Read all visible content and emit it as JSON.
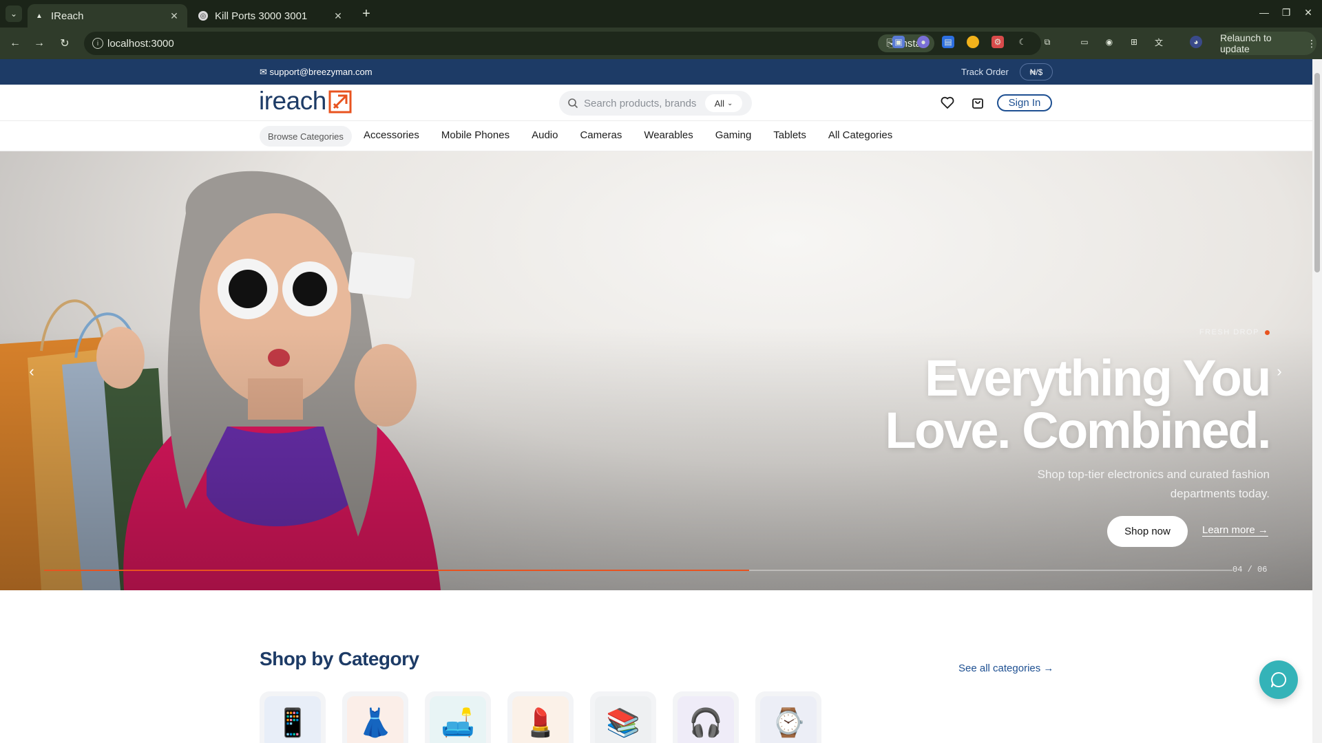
{
  "browser": {
    "tabs": [
      {
        "title": "IReach",
        "active": true
      },
      {
        "title": "Kill Ports 3000 3001",
        "active": false
      }
    ],
    "url": "localhost:3000",
    "install_label": "Install",
    "relaunch_label": "Relaunch to update",
    "theme_color": "#2f3b2a"
  },
  "topbar": {
    "email": "✉ support@breezyman.com",
    "track_order": "Track Order",
    "currency": "₦/$",
    "background": "#1d3b66"
  },
  "header": {
    "logo_text": "ireach",
    "search_placeholder": "Search products, brands",
    "search_filter": "All",
    "signin_label": "Sign In"
  },
  "nav": {
    "browse_label": "Browse Categories",
    "links": [
      "Accessories",
      "Mobile Phones",
      "Audio",
      "Cameras",
      "Wearables",
      "Gaming",
      "Tablets",
      "All Categories"
    ]
  },
  "hero": {
    "eyebrow": "FRESH DROP",
    "headline_line1": "Everything You",
    "headline_line2": "Love. Combined.",
    "subhead": "Shop top-tier electronics and curated fashion departments today.",
    "primary_cta": "Shop now",
    "secondary_cta": "Learn more →",
    "slide_counter": "04 / 06",
    "slide_progress": 0.593,
    "accent": "#e8531f"
  },
  "categories": {
    "title": "Shop by Category",
    "see_all": "See all categories →",
    "tiles": [
      {
        "icon": "📱",
        "icon_name": "mobile-phone-icon",
        "bg": "#e8eef8"
      },
      {
        "icon": "👗",
        "icon_name": "dress-icon",
        "bg": "#fbeee8"
      },
      {
        "icon": "🛋️",
        "icon_name": "sofa-lamp-icon",
        "bg": "#e8f4f5"
      },
      {
        "icon": "💄",
        "icon_name": "lipstick-icon",
        "bg": "#fbf1e8"
      },
      {
        "icon": "📚",
        "icon_name": "books-icon",
        "bg": "#eef0f2"
      },
      {
        "icon": "🎧",
        "icon_name": "headphones-icon",
        "bg": "#efecf8"
      },
      {
        "icon": "⌚",
        "icon_name": "watch-icon",
        "bg": "#eceef6"
      }
    ]
  }
}
